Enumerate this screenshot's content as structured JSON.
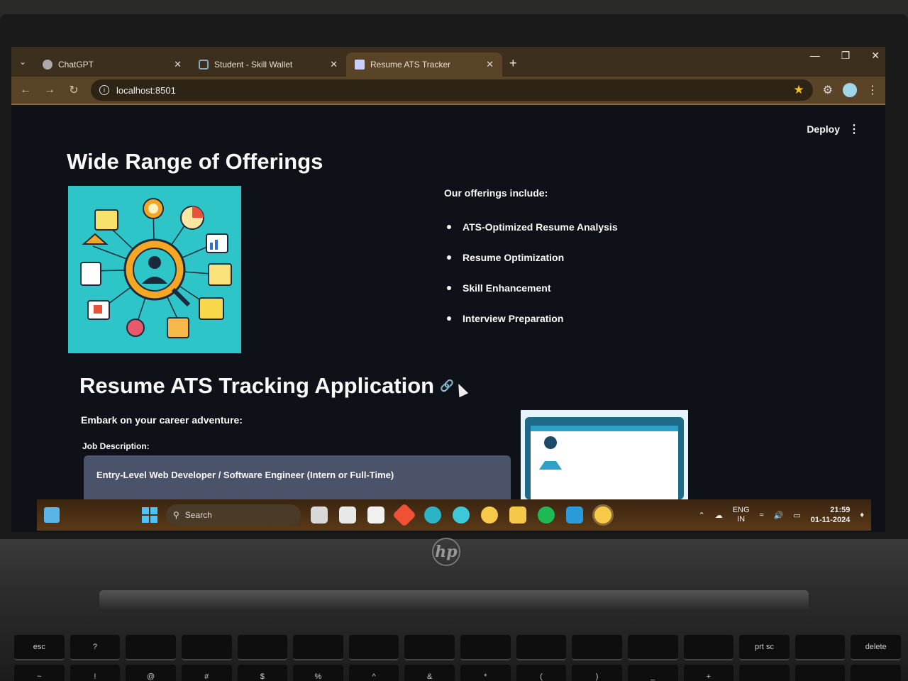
{
  "browser": {
    "tabs": [
      {
        "title": "ChatGPT",
        "active": false
      },
      {
        "title": "Student - Skill Wallet",
        "active": false
      },
      {
        "title": "Resume ATS Tracker",
        "active": true
      }
    ],
    "url": "localhost:8501"
  },
  "streamlit": {
    "deploy_label": "Deploy"
  },
  "offerings": {
    "heading": "Wide Range of Offerings",
    "intro": "Our offerings include:",
    "items": [
      "ATS-Optimized Resume Analysis",
      "Resume Optimization",
      "Skill Enhancement",
      "Interview Preparation"
    ]
  },
  "app": {
    "title": "Resume ATS Tracking Application",
    "tagline": "Embark on your career adventure:",
    "jd_label": "Job Description:",
    "jd_value": "Entry-Level Web Developer / Software Engineer (Intern or Full-Time)"
  },
  "taskbar": {
    "search_placeholder": "Search",
    "lang_top": "ENG",
    "lang_bottom": "IN",
    "time": "21:59",
    "date": "01-11-2024"
  },
  "device": {
    "logo": "hp"
  },
  "keyboard": {
    "fn_row": [
      "esc",
      "?",
      "",
      "",
      "",
      "",
      "",
      "",
      "",
      "",
      "",
      "",
      "",
      "prt sc",
      "",
      "delete"
    ],
    "num_row": [
      "~",
      "!",
      "@",
      "#",
      "$",
      "%",
      "^",
      "&",
      "*",
      "(",
      ")",
      "_",
      "+",
      "",
      "",
      ""
    ]
  },
  "colors": {
    "page_bg": "#0e1117",
    "tab_bar": "#3c2f1e",
    "toolbar": "#5a4428",
    "input_bg": "#4a536a",
    "image_teal": "#2ec5c9"
  }
}
